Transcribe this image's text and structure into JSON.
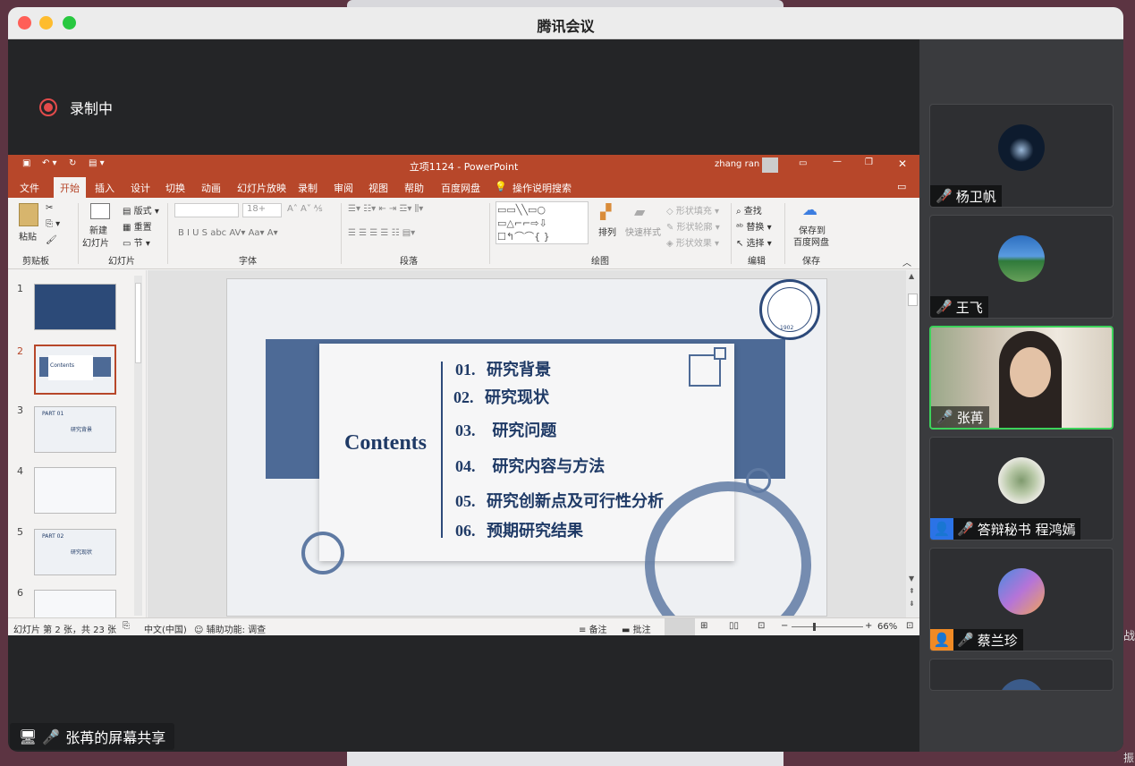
{
  "window": {
    "title": "腾讯会议"
  },
  "desktop": {
    "right_text_1": "战",
    "right_text_2": "振"
  },
  "recording": {
    "label": "录制中"
  },
  "ppt": {
    "title": "立项1124 - PowerPoint",
    "user": "zhang ran",
    "tabs": [
      "文件",
      "开始",
      "插入",
      "设计",
      "切换",
      "动画",
      "幻灯片放映",
      "录制",
      "审阅",
      "视图",
      "帮助",
      "百度网盘"
    ],
    "tell_me": "操作说明搜索",
    "ribbon": {
      "paste": "粘贴",
      "clipboard": "剪贴板",
      "new_slide": "新建",
      "new_slide2": "幻灯片",
      "layout": "版式",
      "reset": "重置",
      "section": "节",
      "slides_group": "幻灯片",
      "font_size": "18+",
      "font_group": "字体",
      "para_group": "段落",
      "arrange": "排列",
      "quick_style": "快速样式",
      "shape_fill": "形状填充",
      "shape_outline": "形状轮廓",
      "shape_effect": "形状效果",
      "drawing_group": "绘图",
      "find": "查找",
      "replace": "替换",
      "select": "选择",
      "editing_group": "编辑",
      "save_baidu_1": "保存到",
      "save_baidu_2": "百度网盘",
      "save_group": "保存"
    },
    "thumbs": [
      "1",
      "2",
      "3",
      "4",
      "5",
      "6"
    ],
    "thumb_text": {
      "t3a": "PART 01",
      "t3b": "研究背景",
      "t5a": "PART 02",
      "t5b": "研究现状",
      "t2": "Contents"
    },
    "slide": {
      "contents_label": "Contents",
      "items": [
        {
          "num": "01.",
          "text": "研究背景"
        },
        {
          "num": "02.",
          "text": "研究现状"
        },
        {
          "num": "03.",
          "text": "研究问题"
        },
        {
          "num": "04.",
          "text": "研究内容与方法"
        },
        {
          "num": "05.",
          "text": "研究创新点及可行性分析"
        },
        {
          "num": "06.",
          "text": "预期研究结果"
        }
      ],
      "logo_year": "1902"
    },
    "status": {
      "slide_info": "幻灯片 第 2 张，共 23 张",
      "language": "中文(中国)",
      "accessibility": "辅助功能: 调查",
      "notes": "备注",
      "comments": "批注",
      "zoom": "66%"
    }
  },
  "participants": [
    {
      "name": "杨卫帆",
      "muted": true,
      "color": "#0d1b2e"
    },
    {
      "name": "王飞",
      "muted": true,
      "color": "#3b6fb0"
    },
    {
      "name": "张苒",
      "muted": false,
      "color": "#c7b9a8"
    },
    {
      "name": "答辩秘书 程鸿嫣",
      "muted": true,
      "color": "#9aa88e"
    },
    {
      "name": "蔡兰珍",
      "muted": false,
      "color": "#8e7ad6"
    }
  ],
  "share": {
    "label": "张苒的屏幕共享"
  }
}
